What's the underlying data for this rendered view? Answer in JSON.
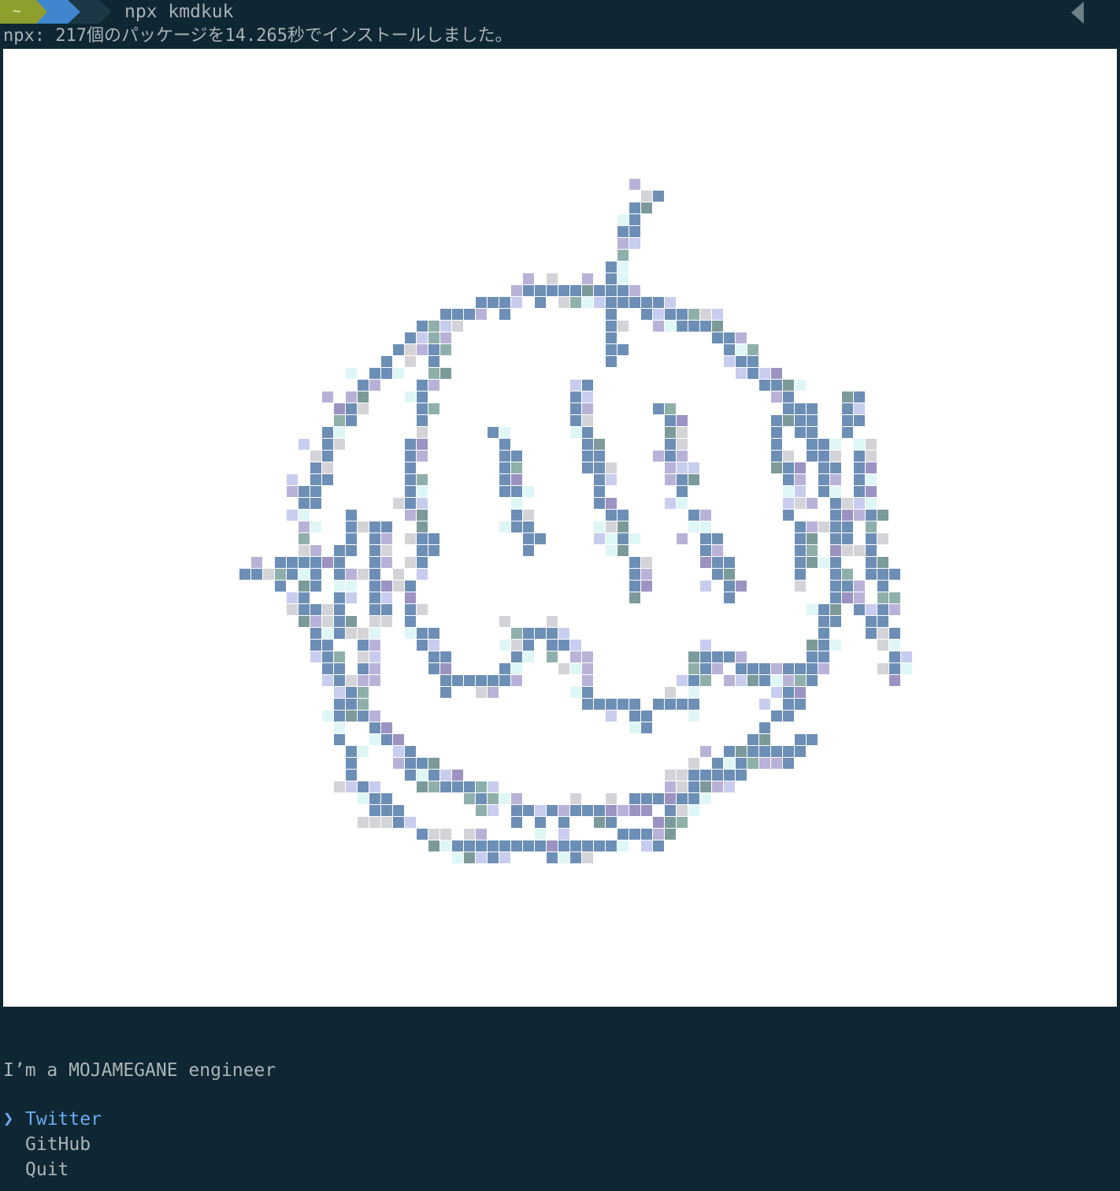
{
  "prompt": {
    "home_symbol": "~",
    "command": "npx kmdkuk",
    "colors": {
      "home": "#8e9f2e",
      "path": "#3f86cf",
      "tail": "#1c3846"
    }
  },
  "output": {
    "npx_message": "npx: 217個のパッケージを14.265秒でインストールしました。"
  },
  "image": {
    "description_icon": "pixel-art-avatar-icon"
  },
  "tagline": "I’m a MOJAMEGANE engineer",
  "menu": {
    "pointer": "❯",
    "items": [
      {
        "label": "Twitter",
        "selected": true
      },
      {
        "label": "GitHub",
        "selected": false
      },
      {
        "label": "Quit",
        "selected": false
      }
    ]
  },
  "colors": {
    "background": "#0f2733",
    "selected": "#6aaaf0",
    "text": "#aab4b8"
  }
}
